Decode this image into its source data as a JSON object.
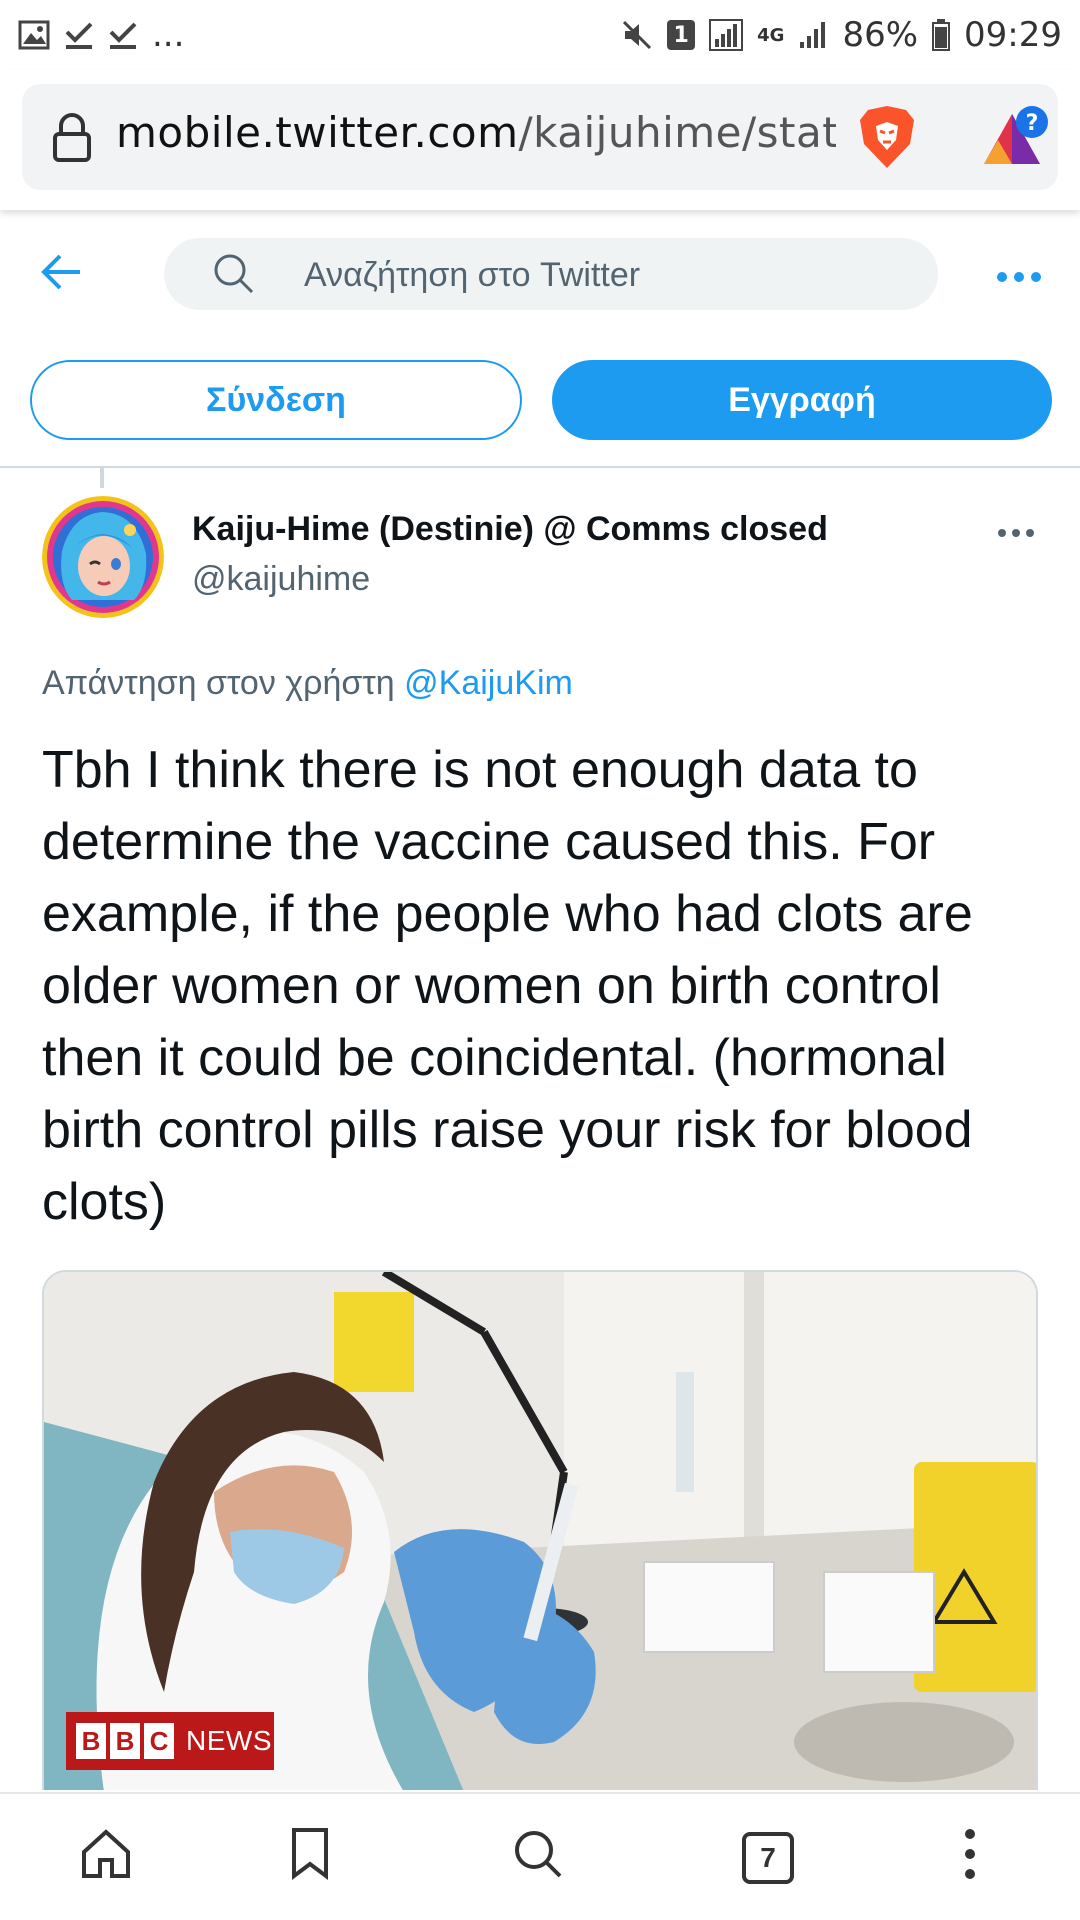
{
  "status_bar": {
    "battery": "86%",
    "time": "09:29",
    "sim": "1",
    "network": "4G",
    "overflow": "..."
  },
  "browser": {
    "url_host": "mobile.twitter.com",
    "url_path": "/kaijuhime/statu",
    "tabs_count": "7"
  },
  "twitter": {
    "search_placeholder": "Αναζήτηση στο Twitter",
    "login_label": "Σύνδεση",
    "signup_label": "Εγγραφή"
  },
  "tweet": {
    "display_name": "Kaiju-Hime (Destinie) @ Comms closed",
    "handle": "@kaijuhime",
    "reply_prefix": "Απάντηση στον χρήστη",
    "reply_mention": "@KaijuKim",
    "text": "Tbh I think there is not enough data to determine the vaccine caused this. For example, if the people who had clots are older women or women on birth control then it could be coincidental. (hormonal birth control pills raise your risk for blood clots)",
    "media_source_letters": [
      "B",
      "B",
      "C"
    ],
    "media_source_word": "NEWS"
  },
  "colors": {
    "accent": "#1d9bf0",
    "secondary_text": "#536471",
    "bbc_red": "#bb1919"
  }
}
